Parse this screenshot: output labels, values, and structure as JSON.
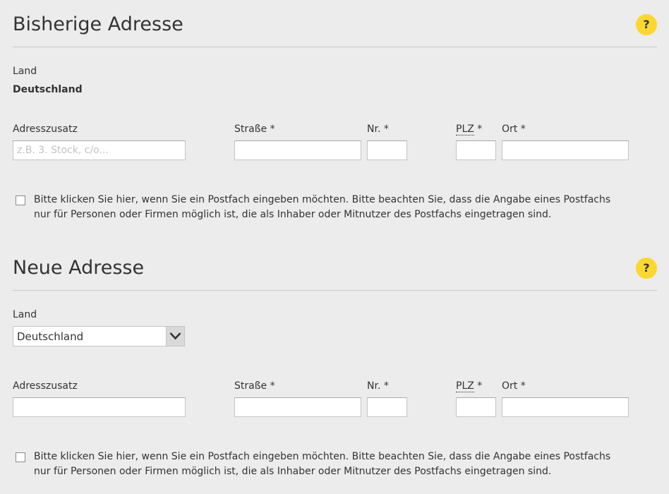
{
  "old_address": {
    "title": "Bisherige Adresse",
    "help_glyph": "?",
    "land_label": "Land",
    "land_value": "Deutschland",
    "fields": {
      "adresszusatz_label": "Adresszusatz",
      "adresszusatz_placeholder": "z.B. 3. Stock, c/o...",
      "strasse_label": "Straße *",
      "nr_label": "Nr. *",
      "plz_abbr": "PLZ",
      "plz_suffix": " *",
      "ort_label": "Ort *"
    },
    "postfach_text": "Bitte klicken Sie hier, wenn Sie ein Postfach eingeben möchten. Bitte beachten Sie, dass die Angabe eines Postfachs nur für Personen oder Firmen möglich ist, die als Inhaber oder Mitnutzer des Postfachs eingetragen sind."
  },
  "new_address": {
    "title": "Neue Adresse",
    "help_glyph": "?",
    "land_label": "Land",
    "land_selected": "Deutschland",
    "fields": {
      "adresszusatz_label": "Adresszusatz",
      "strasse_label": "Straße *",
      "nr_label": "Nr. *",
      "plz_abbr": "PLZ",
      "plz_suffix": " *",
      "ort_label": "Ort *"
    },
    "postfach_text": "Bitte klicken Sie hier, wenn Sie ein Postfach eingeben möchten. Bitte beachten Sie, dass die Angabe eines Postfachs nur für Personen oder Firmen möglich ist, die als Inhaber oder Mitnutzer des Postfachs eingetragen sind."
  },
  "icons": {
    "help": "help-icon",
    "dropdown": "chevron-down-icon"
  },
  "colors": {
    "background": "#ececec",
    "help_badge": "#fcd72f",
    "text": "#333333",
    "placeholder": "#c2c2c2"
  }
}
